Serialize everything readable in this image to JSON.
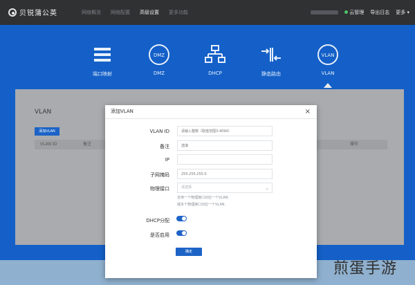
{
  "topbar": {
    "brand": "贝锐蒲公英",
    "nav": [
      "网络概览",
      "网络配置",
      "高级设置",
      "更多功能"
    ],
    "active_index": 2,
    "cloud_manage": "云管理",
    "export_log": "导出日志",
    "more": "更多"
  },
  "features": [
    {
      "label": "端口映射",
      "icon": "port-mapping-icon"
    },
    {
      "label": "DMZ",
      "icon_text": "DMZ"
    },
    {
      "label": "DHCP",
      "icon": "dhcp-network-icon"
    },
    {
      "label": "静态路由",
      "icon": "static-route-icon"
    },
    {
      "label": "VLAN",
      "icon_text": "VLAN",
      "active": true
    }
  ],
  "panel": {
    "title": "VLAN",
    "add_button": "添加VLAN",
    "columns": [
      "VLAN ID",
      "备注",
      "操作"
    ]
  },
  "dialog": {
    "title": "添加VLAN",
    "fields": [
      {
        "label": "VLAN ID",
        "placeholder": "请输入整数（取值范围3-4094）"
      },
      {
        "label": "备注",
        "placeholder": "选填"
      },
      {
        "label": "IP",
        "placeholder": ""
      },
      {
        "label": "子网掩码",
        "placeholder": "255.255.255.0"
      },
      {
        "label": "物理接口",
        "placeholder": "请选择"
      }
    ],
    "hint_line1": "支持一个物理接口对应一个VLAN,",
    "hint_line2": "或多个物理接口对应一个VLAN.",
    "dhcp_label": "DHCP分配",
    "dhcp_enabled": true,
    "enable_label": "是否启用",
    "enabled": true,
    "confirm": "确定"
  },
  "watermark": "煎蛋手游"
}
